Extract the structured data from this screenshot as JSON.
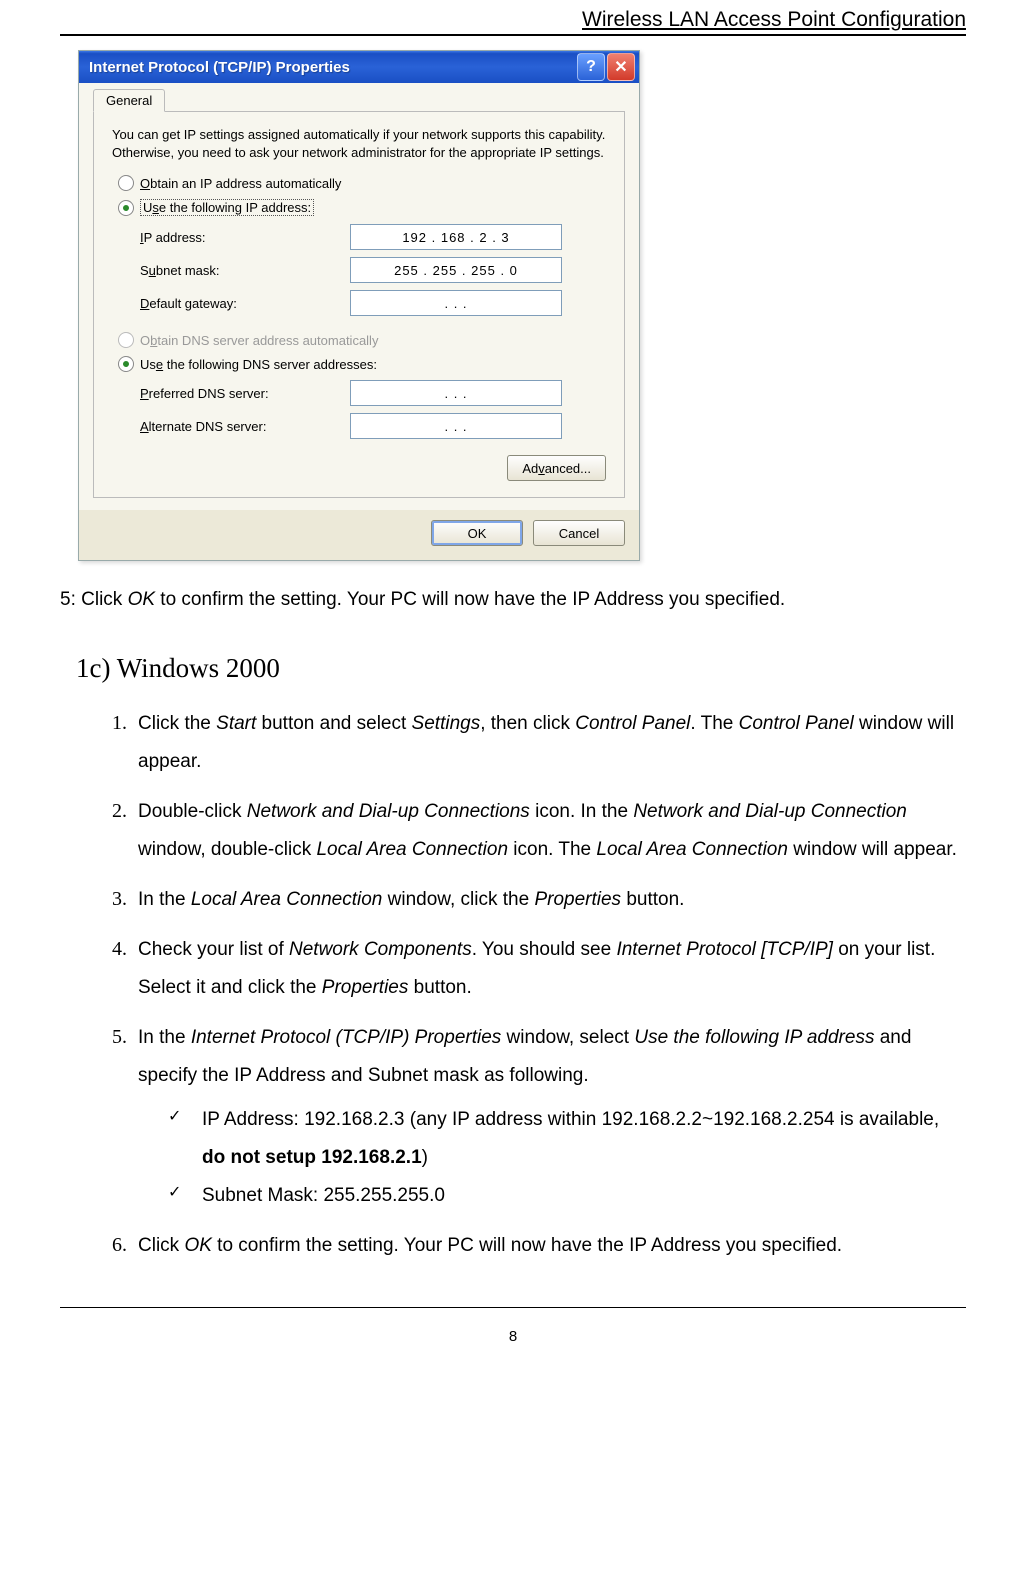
{
  "header": {
    "title": "Wireless LAN Access Point Configuration"
  },
  "dialog": {
    "title": "Internet Protocol (TCP/IP) Properties",
    "help_glyph": "?",
    "close_glyph": "✕",
    "tab": "General",
    "intro": "You can get IP settings assigned automatically if your network supports this capability. Otherwise, you need to ask your network administrator for the appropriate IP settings.",
    "ip_radio_auto": "Obtain an IP address automatically",
    "ip_radio_manual": "Use the following IP address:",
    "ip_label": "IP address:",
    "ip_value": "192 . 168 .   2   .   3",
    "subnet_label": "Subnet mask:",
    "subnet_value": "255 . 255 . 255 .   0",
    "gateway_label": "Default gateway:",
    "gateway_value": ".         .         .",
    "dns_radio_auto": "Obtain DNS server address automatically",
    "dns_radio_manual": "Use the following DNS server addresses:",
    "pref_dns_label": "Preferred DNS server:",
    "pref_dns_value": ".         .         .",
    "alt_dns_label": "Alternate DNS server:",
    "alt_dns_value": ".         .         .",
    "advanced_btn": "Advanced...",
    "ok_btn": "OK",
    "cancel_btn": "Cancel"
  },
  "doc": {
    "step5_prefix": "5: Click ",
    "step5_ok": "OK",
    "step5_suffix": " to confirm the setting. Your PC will now have the IP Address you specified.",
    "section_title": "1c) Windows 2000",
    "s1a": "Click the ",
    "s1_start": "Start",
    "s1b": " button and select ",
    "s1_settings": "Settings",
    "s1c": ", then click ",
    "s1_cp": "Control Panel",
    "s1d": ". The ",
    "s1_cp2": "Control Panel",
    "s1e": " window will appear.",
    "s2a": "Double-click ",
    "s2_ndc": "Network and Dial-up Connections",
    "s2b": " icon. In the ",
    "s2_ndc2": "Network and Dial-up Connection",
    "s2c": " window, double-click ",
    "s2_lac": "Local Area Connection",
    "s2d": " icon. The ",
    "s2_lac2": "Local Area Connection",
    "s2e": " window will appear.",
    "s3a": "In the ",
    "s3_lac": "Local Area Connection",
    "s3b": " window, click the ",
    "s3_prop": "Properties",
    "s3c": " button.",
    "s4a": "Check your list of ",
    "s4_nc": "Network Components",
    "s4b": ". You should see ",
    "s4_ip": "Internet Protocol [TCP/IP]",
    "s4c": " on your list. Select it and click the ",
    "s4_prop": "Properties",
    "s4d": " button.",
    "s5a": "In the ",
    "s5_win": "Internet Protocol (TCP/IP) Properties",
    "s5b": " window, select ",
    "s5_use": "Use the following IP address",
    "s5c": " and specify the IP Address and Subnet mask as following.",
    "sub_ip_a": "IP Address: 192.168.2.3 (any IP address within 192.168.2.2~192.168.2.254 is available, ",
    "sub_ip_b": "do not setup 192.168.2.1",
    "sub_ip_c": ")",
    "sub_mask": "Subnet Mask: 255.255.255.0",
    "s6a": "Click ",
    "s6_ok": "OK",
    "s6b": " to confirm the setting. Your PC will now have the IP Address you specified.",
    "page_number": "8"
  }
}
